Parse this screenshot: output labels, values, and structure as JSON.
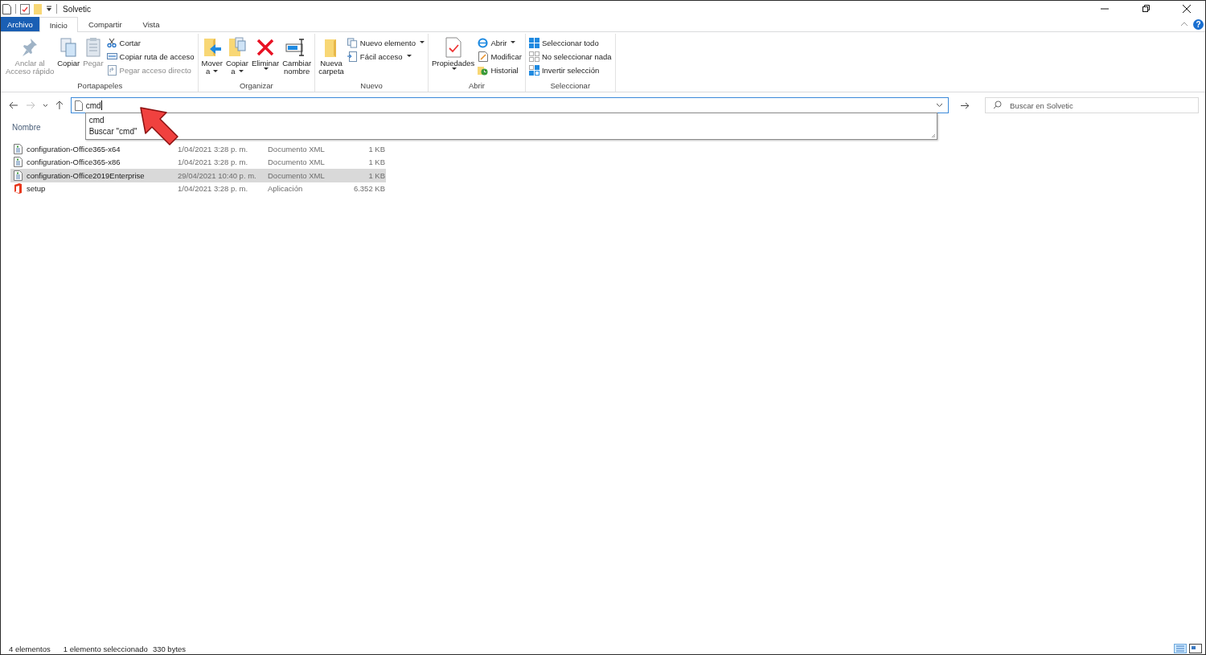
{
  "window": {
    "title": "Solvetic"
  },
  "tabs": [
    {
      "label": "Archivo",
      "kind": "file",
      "selected": false
    },
    {
      "label": "Inicio",
      "kind": "tab",
      "selected": true
    },
    {
      "label": "Compartir",
      "kind": "tab",
      "selected": false
    },
    {
      "label": "Vista",
      "kind": "tab",
      "selected": false
    }
  ],
  "help": "?",
  "ribbon": {
    "groups": [
      {
        "label": "Portapapeles",
        "items": [
          {
            "kind": "large",
            "lines": [
              "Anclar al",
              "Acceso rápido"
            ],
            "dropdown": false,
            "disabled": true
          },
          {
            "kind": "large",
            "lines": [
              "Copiar"
            ],
            "dropdown": false,
            "disabled": false
          },
          {
            "kind": "large",
            "lines": [
              "Pegar"
            ],
            "dropdown": false,
            "disabled": true
          },
          {
            "kind": "stack",
            "entries": [
              {
                "label": "Cortar",
                "dropdown": false,
                "disabled": false
              },
              {
                "label": "Copiar ruta de acceso",
                "dropdown": false,
                "disabled": false
              },
              {
                "label": "Pegar acceso directo",
                "dropdown": false,
                "disabled": true
              }
            ]
          }
        ]
      },
      {
        "label": "Organizar",
        "items": [
          {
            "kind": "large",
            "lines": [
              "Mover",
              "a"
            ],
            "dropdown": true,
            "disabled": false
          },
          {
            "kind": "large",
            "lines": [
              "Copiar",
              "a"
            ],
            "dropdown": true,
            "disabled": false
          },
          {
            "kind": "large",
            "lines": [
              "Eliminar"
            ],
            "dropdown": true,
            "disabled": false
          },
          {
            "kind": "large",
            "lines": [
              "Cambiar",
              "nombre"
            ],
            "dropdown": false,
            "disabled": false
          }
        ]
      },
      {
        "label": "Nuevo",
        "items": [
          {
            "kind": "large",
            "lines": [
              "Nueva",
              "carpeta"
            ],
            "dropdown": false,
            "disabled": false
          },
          {
            "kind": "stack",
            "entries": [
              {
                "label": "Nuevo elemento",
                "dropdown": true,
                "disabled": false
              },
              {
                "label": "Fácil acceso",
                "dropdown": true,
                "disabled": false
              }
            ]
          }
        ]
      },
      {
        "label": "Abrir",
        "items": [
          {
            "kind": "large",
            "lines": [
              "Propiedades"
            ],
            "dropdown": true,
            "disabled": false
          },
          {
            "kind": "stack",
            "entries": [
              {
                "label": "Abrir",
                "dropdown": true,
                "disabled": false
              },
              {
                "label": "Modificar",
                "dropdown": false,
                "disabled": false
              },
              {
                "label": "Historial",
                "dropdown": false,
                "disabled": false
              }
            ]
          }
        ]
      },
      {
        "label": "Seleccionar",
        "items": [
          {
            "kind": "stack",
            "entries": [
              {
                "label": "Seleccionar todo",
                "dropdown": false,
                "disabled": false
              },
              {
                "label": "No seleccionar nada",
                "dropdown": false,
                "disabled": false
              },
              {
                "label": "Invertir selección",
                "dropdown": false,
                "disabled": false
              }
            ]
          }
        ]
      }
    ]
  },
  "address": {
    "value": "cmd",
    "suggestions": [
      "cmd",
      "Buscar \"cmd\""
    ]
  },
  "search": {
    "placeholder": "Buscar en Solvetic"
  },
  "table": {
    "columns": [
      "Nombre"
    ],
    "rows": [
      {
        "kind": "xml",
        "name": "configuration-Office365-x64",
        "date": "1/04/2021 3:28 p. m.",
        "type": "Documento XML",
        "size": "1 KB",
        "selected": false
      },
      {
        "kind": "xml",
        "name": "configuration-Office365-x86",
        "date": "1/04/2021 3:28 p. m.",
        "type": "Documento XML",
        "size": "1 KB",
        "selected": false
      },
      {
        "kind": "xml",
        "name": "configuration-Office2019Enterprise",
        "date": "29/04/2021 10:40 p. m.",
        "type": "Documento XML",
        "size": "1 KB",
        "selected": true
      },
      {
        "kind": "app",
        "name": "setup",
        "date": "1/04/2021 3:28 p. m.",
        "type": "Aplicación",
        "size": "6.352 KB",
        "selected": false
      }
    ]
  },
  "status_bar": {
    "count": "4 elementos",
    "selection": "1 elemento seleccionado",
    "size": "330 bytes"
  }
}
